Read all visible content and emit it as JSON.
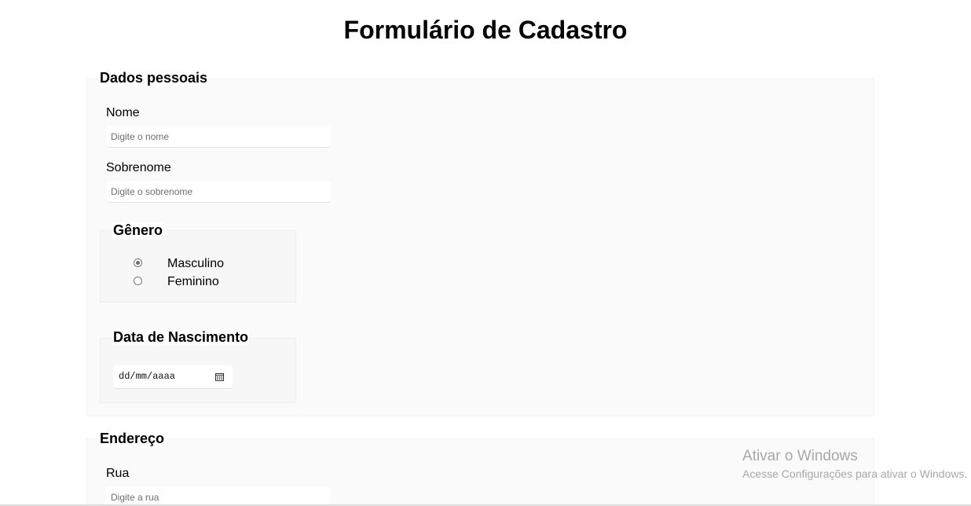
{
  "page": {
    "title": "Formulário de Cadastro"
  },
  "personal": {
    "legend": "Dados pessoais",
    "first_name": {
      "label": "Nome",
      "placeholder": "Digite o nome",
      "value": ""
    },
    "last_name": {
      "label": "Sobrenome",
      "placeholder": "Digite o sobrenome",
      "value": ""
    },
    "gender": {
      "legend": "Gênero",
      "options": [
        {
          "label": "Masculino",
          "checked": true
        },
        {
          "label": "Feminino",
          "checked": false
        }
      ]
    },
    "birth_date": {
      "legend": "Data de Nascimento",
      "placeholder": "dd/mm/aaaa",
      "icon": "calendar-icon"
    }
  },
  "address": {
    "legend": "Endereço",
    "street": {
      "label": "Rua",
      "placeholder": "Digite a rua",
      "value": ""
    }
  },
  "watermark": {
    "title": "Ativar o Windows",
    "subtitle": "Acesse Configurações para ativar o Windows."
  }
}
